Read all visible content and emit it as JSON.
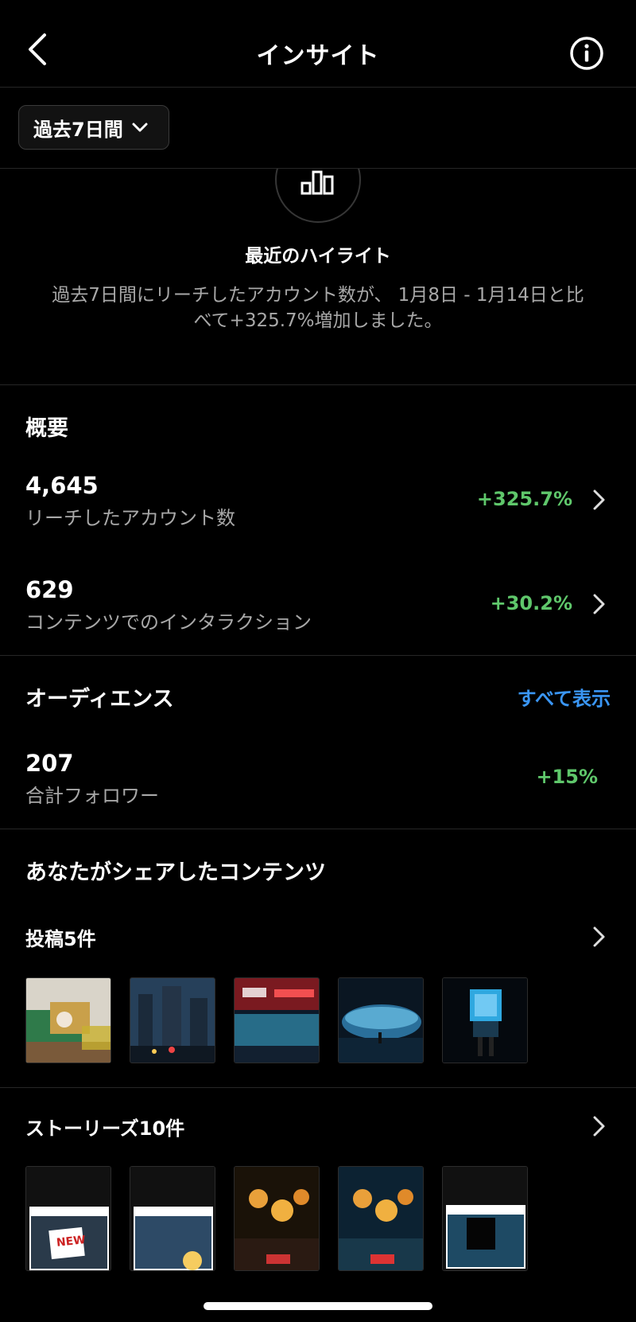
{
  "header": {
    "title": "インサイト",
    "back_icon": "chevron-left-icon",
    "info_icon": "info-icon"
  },
  "range": {
    "label": "過去7日間"
  },
  "highlight": {
    "title": "最近のハイライト",
    "text": "過去7日間にリーチしたアカウント数が、 1月8日 - 1月14日と比べて+325.7%増加しました。"
  },
  "overview": {
    "title": "概要",
    "metrics": [
      {
        "value": "4,645",
        "label": "リーチしたアカウント数",
        "change": "+325.7%"
      },
      {
        "value": "629",
        "label": "コンテンツでのインタラクション",
        "change": "+30.2%"
      }
    ]
  },
  "audience": {
    "title": "オーディエンス",
    "see_all": "すべて表示",
    "metric": {
      "value": "207",
      "label": "合計フォロワー",
      "change": "+15%"
    }
  },
  "content": {
    "title": "あなたがシェアしたコンテンツ",
    "posts": {
      "label": "投稿5件"
    },
    "stories": {
      "label": "ストーリーズ10件"
    }
  },
  "story_stickers": [
    "NEW"
  ],
  "colors": {
    "background": "#000000",
    "positive": "#5fc76b",
    "link": "#3a96f5",
    "secondary_text": "#a8a8a8"
  }
}
